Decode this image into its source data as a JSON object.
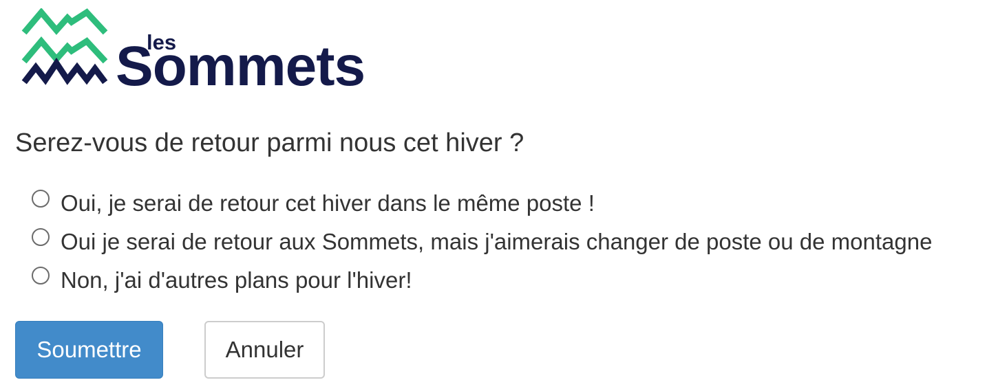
{
  "logo": {
    "small_text": "les",
    "big_text": "Sommets",
    "mark_icon": "mountain-chevrons-icon",
    "colors": {
      "green": "#2ebd7c",
      "navy": "#141a4a"
    }
  },
  "form": {
    "question": "Serez-vous de retour parmi nous cet hiver ?",
    "options": [
      {
        "label": "Oui, je serai de retour cet hiver dans le même poste !",
        "selected": false
      },
      {
        "label": "Oui je serai de retour aux Sommets, mais j'aimerais changer de poste ou de montagne",
        "selected": false
      },
      {
        "label": "Non, j'ai d'autres plans pour l'hiver!",
        "selected": false
      }
    ],
    "submit_label": "Soumettre",
    "cancel_label": "Annuler",
    "colors": {
      "submit_bg": "#428bca",
      "text": "#333333"
    }
  }
}
